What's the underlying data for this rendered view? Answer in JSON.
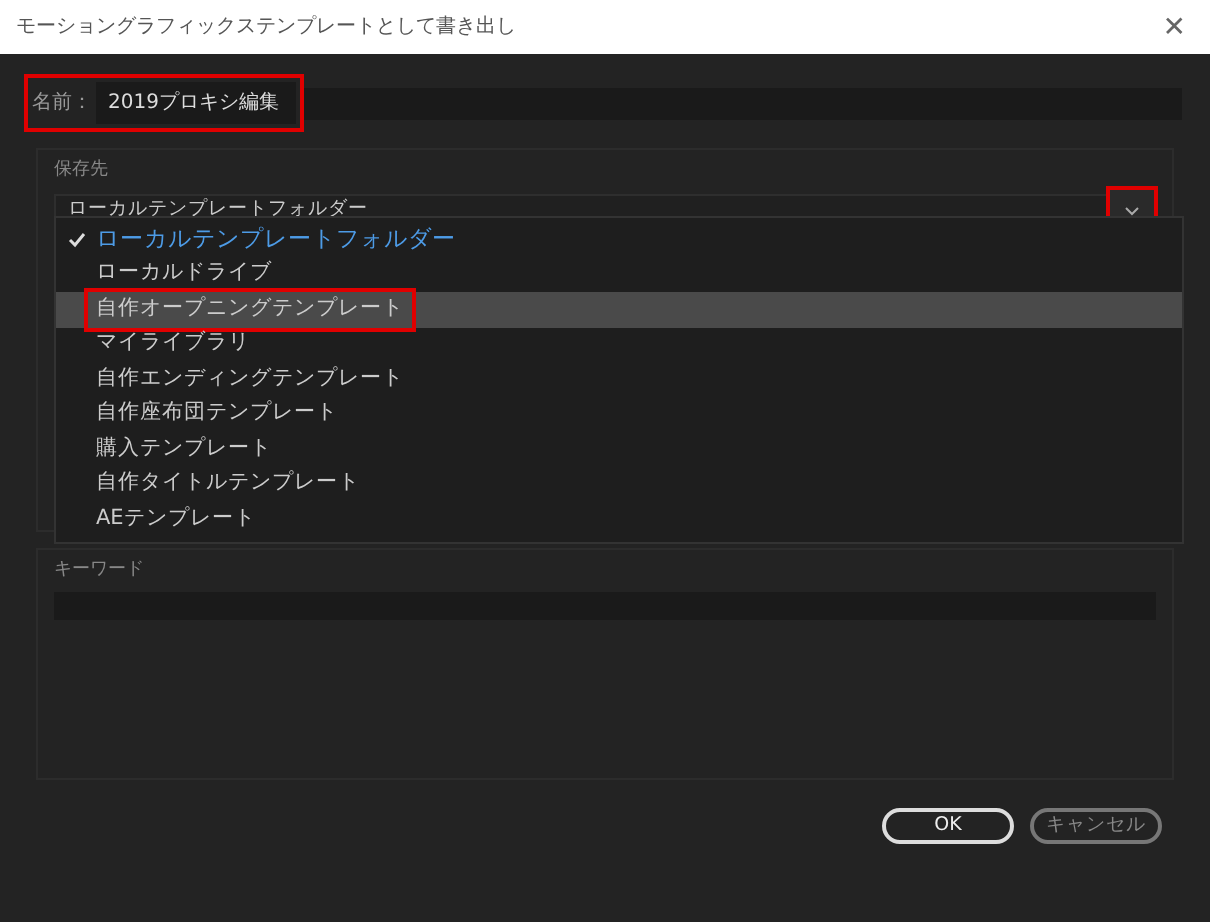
{
  "window": {
    "title": "モーショングラフィックステンプレートとして書き出し",
    "close": "✕"
  },
  "name_field": {
    "label": "名前：",
    "value": "2019プロキシ編集",
    "highlighted": true
  },
  "destination": {
    "label": "保存先",
    "value": "ローカルテンプレートフォルダー",
    "arrow_highlighted": true,
    "options": [
      {
        "label": "ローカルテンプレートフォルダー",
        "checked": true,
        "hovered": false,
        "highlighted": false
      },
      {
        "label": "ローカルドライブ",
        "checked": false,
        "hovered": false,
        "highlighted": false
      },
      {
        "label": "自作オープニングテンプレート",
        "checked": false,
        "hovered": true,
        "highlighted": true
      },
      {
        "label": "マイライブラリ",
        "checked": false,
        "hovered": false,
        "highlighted": false
      },
      {
        "label": "自作エンディングテンプレート",
        "checked": false,
        "hovered": false,
        "highlighted": false
      },
      {
        "label": "自作座布団テンプレート",
        "checked": false,
        "hovered": false,
        "highlighted": false
      },
      {
        "label": "購入テンプレート",
        "checked": false,
        "hovered": false,
        "highlighted": false
      },
      {
        "label": "自作タイトルテンプレート",
        "checked": false,
        "hovered": false,
        "highlighted": false
      },
      {
        "label": "AEテンプレート",
        "checked": false,
        "hovered": false,
        "highlighted": false
      }
    ]
  },
  "keywords": {
    "label": "キーワード"
  },
  "buttons": [
    {
      "label": "OK",
      "kind": "primary"
    },
    {
      "label": "キャンセル",
      "kind": "secondary"
    }
  ]
}
